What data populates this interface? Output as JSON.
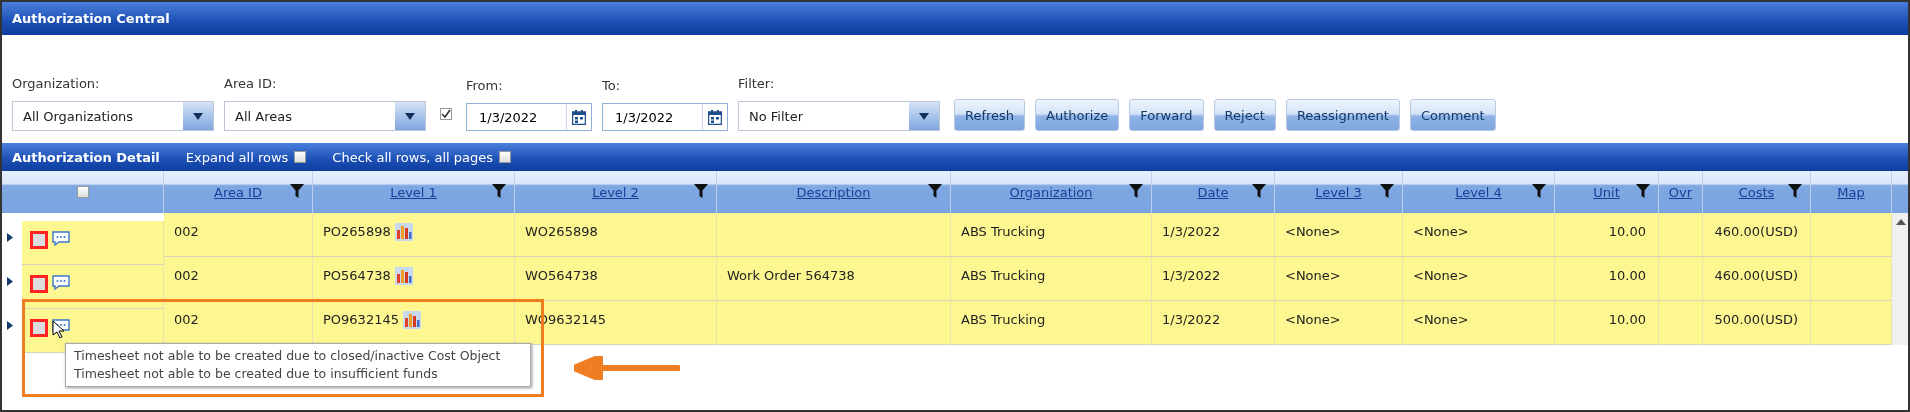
{
  "window": {
    "title": "Authorization Central"
  },
  "filters": [
    {
      "kind": "dropdown",
      "label": "Organization:",
      "value": "All Organizations"
    },
    {
      "kind": "dropdown",
      "label": "Area ID:",
      "value": "All Areas"
    },
    {
      "kind": "checkbox",
      "checked": true
    },
    {
      "kind": "date",
      "label": "From:",
      "value": "1/3/2022"
    },
    {
      "kind": "date",
      "label": "To:",
      "value": "1/3/2022"
    },
    {
      "kind": "dropdown",
      "label": "Filter:",
      "value": "No Filter"
    }
  ],
  "buttons": [
    "Refresh",
    "Authorize",
    "Forward",
    "Reject",
    "Reassignment",
    "Comment"
  ],
  "detail_bar": {
    "title": "Authorization Detail",
    "options": [
      {
        "label": "Expand all rows",
        "checked": false
      },
      {
        "label": "Check all rows, all pages",
        "checked": false
      }
    ]
  },
  "table": {
    "select_all_checked": false,
    "columns": [
      {
        "label": "Area ID",
        "filter": true,
        "kind": "text"
      },
      {
        "label": "Level 1",
        "filter": true,
        "kind": "chart_link"
      },
      {
        "label": "Level 2",
        "filter": true,
        "kind": "text"
      },
      {
        "label": "Description",
        "filter": true,
        "kind": "text"
      },
      {
        "label": "Organization",
        "filter": true,
        "kind": "text"
      },
      {
        "label": "Date",
        "filter": true,
        "kind": "text"
      },
      {
        "label": "Level 3",
        "filter": true,
        "kind": "text"
      },
      {
        "label": "Level 4",
        "filter": true,
        "kind": "text"
      },
      {
        "label": "Unit",
        "filter": true,
        "kind": "number"
      },
      {
        "label": "Ovr",
        "filter": false,
        "kind": "text"
      },
      {
        "label": "Costs",
        "filter": true,
        "kind": "number"
      },
      {
        "label": "Map",
        "filter": false,
        "kind": "text"
      }
    ],
    "rows": [
      {
        "checked": false,
        "cells": [
          "002",
          "PO265898",
          "WO265898",
          null,
          "ABS Trucking",
          "1/3/2022",
          "<None>",
          "<None>",
          "10.00",
          null,
          "460.00(USD)",
          null
        ]
      },
      {
        "checked": false,
        "cells": [
          "002",
          "PO564738",
          "WO564738",
          "Work Order 564738",
          "ABS Trucking",
          "1/3/2022",
          "<None>",
          "<None>",
          "10.00",
          null,
          "460.00(USD)",
          null
        ]
      },
      {
        "checked": false,
        "cells": [
          "002",
          "PO9632145",
          "WO9632145",
          null,
          "ABS Trucking",
          "1/3/2022",
          "<None>",
          "<None>",
          "10.00",
          null,
          "500.00(USD)",
          null
        ]
      }
    ]
  },
  "tooltip": {
    "lines": [
      "Timesheet not able to be created due to closed/inactive Cost Object",
      "Timesheet not able to be created due to insufficient funds"
    ]
  }
}
